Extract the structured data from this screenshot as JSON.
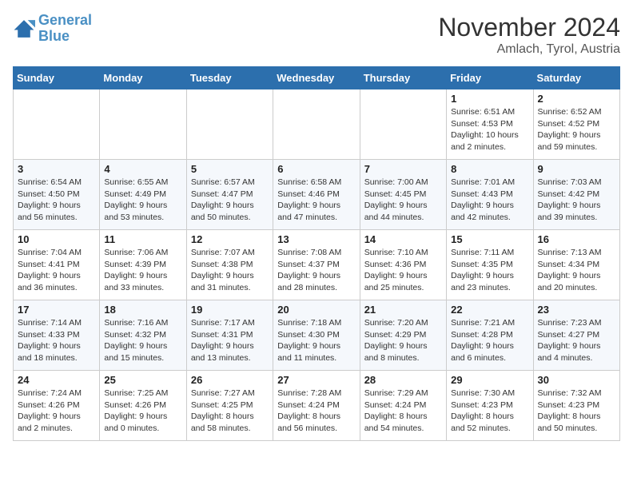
{
  "logo": {
    "line1": "General",
    "line2": "Blue"
  },
  "title": "November 2024",
  "location": "Amlach, Tyrol, Austria",
  "days_of_week": [
    "Sunday",
    "Monday",
    "Tuesday",
    "Wednesday",
    "Thursday",
    "Friday",
    "Saturday"
  ],
  "weeks": [
    [
      null,
      null,
      null,
      null,
      null,
      {
        "day": "1",
        "sunrise": "Sunrise: 6:51 AM",
        "sunset": "Sunset: 4:53 PM",
        "daylight": "Daylight: 10 hours and 2 minutes."
      },
      {
        "day": "2",
        "sunrise": "Sunrise: 6:52 AM",
        "sunset": "Sunset: 4:52 PM",
        "daylight": "Daylight: 9 hours and 59 minutes."
      }
    ],
    [
      {
        "day": "3",
        "sunrise": "Sunrise: 6:54 AM",
        "sunset": "Sunset: 4:50 PM",
        "daylight": "Daylight: 9 hours and 56 minutes."
      },
      {
        "day": "4",
        "sunrise": "Sunrise: 6:55 AM",
        "sunset": "Sunset: 4:49 PM",
        "daylight": "Daylight: 9 hours and 53 minutes."
      },
      {
        "day": "5",
        "sunrise": "Sunrise: 6:57 AM",
        "sunset": "Sunset: 4:47 PM",
        "daylight": "Daylight: 9 hours and 50 minutes."
      },
      {
        "day": "6",
        "sunrise": "Sunrise: 6:58 AM",
        "sunset": "Sunset: 4:46 PM",
        "daylight": "Daylight: 9 hours and 47 minutes."
      },
      {
        "day": "7",
        "sunrise": "Sunrise: 7:00 AM",
        "sunset": "Sunset: 4:45 PM",
        "daylight": "Daylight: 9 hours and 44 minutes."
      },
      {
        "day": "8",
        "sunrise": "Sunrise: 7:01 AM",
        "sunset": "Sunset: 4:43 PM",
        "daylight": "Daylight: 9 hours and 42 minutes."
      },
      {
        "day": "9",
        "sunrise": "Sunrise: 7:03 AM",
        "sunset": "Sunset: 4:42 PM",
        "daylight": "Daylight: 9 hours and 39 minutes."
      }
    ],
    [
      {
        "day": "10",
        "sunrise": "Sunrise: 7:04 AM",
        "sunset": "Sunset: 4:41 PM",
        "daylight": "Daylight: 9 hours and 36 minutes."
      },
      {
        "day": "11",
        "sunrise": "Sunrise: 7:06 AM",
        "sunset": "Sunset: 4:39 PM",
        "daylight": "Daylight: 9 hours and 33 minutes."
      },
      {
        "day": "12",
        "sunrise": "Sunrise: 7:07 AM",
        "sunset": "Sunset: 4:38 PM",
        "daylight": "Daylight: 9 hours and 31 minutes."
      },
      {
        "day": "13",
        "sunrise": "Sunrise: 7:08 AM",
        "sunset": "Sunset: 4:37 PM",
        "daylight": "Daylight: 9 hours and 28 minutes."
      },
      {
        "day": "14",
        "sunrise": "Sunrise: 7:10 AM",
        "sunset": "Sunset: 4:36 PM",
        "daylight": "Daylight: 9 hours and 25 minutes."
      },
      {
        "day": "15",
        "sunrise": "Sunrise: 7:11 AM",
        "sunset": "Sunset: 4:35 PM",
        "daylight": "Daylight: 9 hours and 23 minutes."
      },
      {
        "day": "16",
        "sunrise": "Sunrise: 7:13 AM",
        "sunset": "Sunset: 4:34 PM",
        "daylight": "Daylight: 9 hours and 20 minutes."
      }
    ],
    [
      {
        "day": "17",
        "sunrise": "Sunrise: 7:14 AM",
        "sunset": "Sunset: 4:33 PM",
        "daylight": "Daylight: 9 hours and 18 minutes."
      },
      {
        "day": "18",
        "sunrise": "Sunrise: 7:16 AM",
        "sunset": "Sunset: 4:32 PM",
        "daylight": "Daylight: 9 hours and 15 minutes."
      },
      {
        "day": "19",
        "sunrise": "Sunrise: 7:17 AM",
        "sunset": "Sunset: 4:31 PM",
        "daylight": "Daylight: 9 hours and 13 minutes."
      },
      {
        "day": "20",
        "sunrise": "Sunrise: 7:18 AM",
        "sunset": "Sunset: 4:30 PM",
        "daylight": "Daylight: 9 hours and 11 minutes."
      },
      {
        "day": "21",
        "sunrise": "Sunrise: 7:20 AM",
        "sunset": "Sunset: 4:29 PM",
        "daylight": "Daylight: 9 hours and 8 minutes."
      },
      {
        "day": "22",
        "sunrise": "Sunrise: 7:21 AM",
        "sunset": "Sunset: 4:28 PM",
        "daylight": "Daylight: 9 hours and 6 minutes."
      },
      {
        "day": "23",
        "sunrise": "Sunrise: 7:23 AM",
        "sunset": "Sunset: 4:27 PM",
        "daylight": "Daylight: 9 hours and 4 minutes."
      }
    ],
    [
      {
        "day": "24",
        "sunrise": "Sunrise: 7:24 AM",
        "sunset": "Sunset: 4:26 PM",
        "daylight": "Daylight: 9 hours and 2 minutes."
      },
      {
        "day": "25",
        "sunrise": "Sunrise: 7:25 AM",
        "sunset": "Sunset: 4:26 PM",
        "daylight": "Daylight: 9 hours and 0 minutes."
      },
      {
        "day": "26",
        "sunrise": "Sunrise: 7:27 AM",
        "sunset": "Sunset: 4:25 PM",
        "daylight": "Daylight: 8 hours and 58 minutes."
      },
      {
        "day": "27",
        "sunrise": "Sunrise: 7:28 AM",
        "sunset": "Sunset: 4:24 PM",
        "daylight": "Daylight: 8 hours and 56 minutes."
      },
      {
        "day": "28",
        "sunrise": "Sunrise: 7:29 AM",
        "sunset": "Sunset: 4:24 PM",
        "daylight": "Daylight: 8 hours and 54 minutes."
      },
      {
        "day": "29",
        "sunrise": "Sunrise: 7:30 AM",
        "sunset": "Sunset: 4:23 PM",
        "daylight": "Daylight: 8 hours and 52 minutes."
      },
      {
        "day": "30",
        "sunrise": "Sunrise: 7:32 AM",
        "sunset": "Sunset: 4:23 PM",
        "daylight": "Daylight: 8 hours and 50 minutes."
      }
    ]
  ]
}
